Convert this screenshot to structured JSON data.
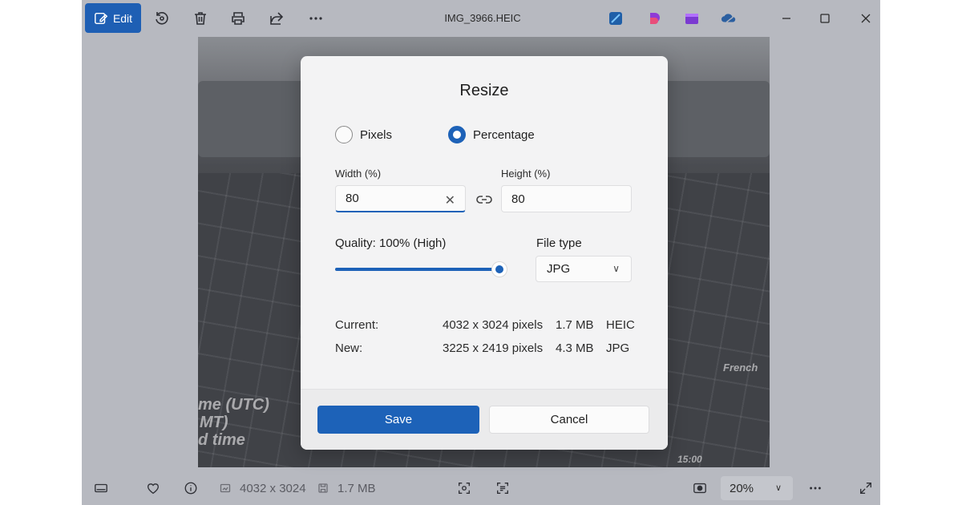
{
  "toolbar": {
    "edit_label": "Edit",
    "file_name": "IMG_3966.HEIC",
    "icons": [
      "edit-icon",
      "rotate-icon",
      "delete-icon",
      "print-icon",
      "share-icon",
      "more-icon"
    ]
  },
  "photo_text": {
    "line1": "me (UTC)",
    "line2": "MT)",
    "line3": "d time",
    "corner": "French",
    "bottom": "15:00"
  },
  "dialog": {
    "title": "Resize",
    "mode_pixels": "Pixels",
    "mode_percentage": "Percentage",
    "selected_mode": "Percentage",
    "width_label": "Width  (%)",
    "height_label": "Height  (%)",
    "width_value": "80",
    "height_value": "80",
    "quality_label": "Quality: 100% (High)",
    "quality_value": 100,
    "file_type_label": "File type",
    "file_type_value": "JPG",
    "current": {
      "label": "Current:",
      "dimensions": "4032 x 3024 pixels",
      "size": "1.7 MB",
      "format": "HEIC"
    },
    "new": {
      "label": "New:",
      "dimensions": "3225 x 2419 pixels",
      "size": "4.3 MB",
      "format": "JPG"
    },
    "save_label": "Save",
    "cancel_label": "Cancel"
  },
  "statusbar": {
    "dimensions": "4032 x 3024",
    "file_size": "1.7 MB",
    "zoom": "20%"
  },
  "colors": {
    "accent": "#1d62b8",
    "edit_button": "#1e5fb4",
    "backdrop": "#b7b9c0"
  }
}
